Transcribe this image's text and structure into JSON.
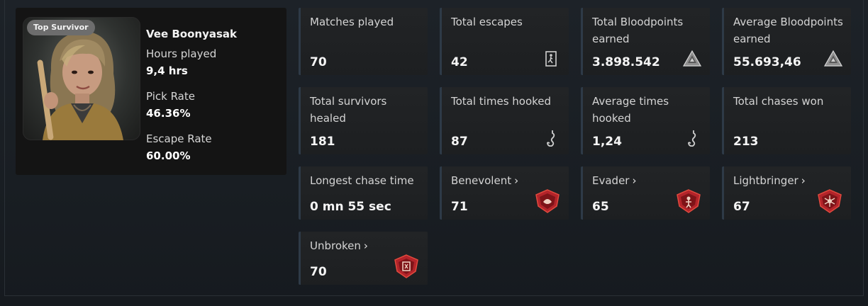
{
  "profile": {
    "badge": "Top Survivor",
    "name": "Vee Boonyasak",
    "stats": [
      {
        "label": "Hours played",
        "value": "9,4 hrs"
      },
      {
        "label": "Pick Rate",
        "value": "46.36%"
      },
      {
        "label": "Escape Rate",
        "value": "60.00%"
      }
    ]
  },
  "stats": [
    {
      "label": "Matches played",
      "value": "70",
      "icon": ""
    },
    {
      "label": "Total escapes",
      "value": "42",
      "icon": "exit-door-icon"
    },
    {
      "label": "Total Bloodpoints earned",
      "value": "3.898.542",
      "icon": "bloodpoints-icon"
    },
    {
      "label": "Average Bloodpoints earned",
      "value": "55.693,46",
      "icon": "bloodpoints-icon"
    },
    {
      "label": "Total survivors healed",
      "value": "181",
      "icon": ""
    },
    {
      "label": "Total times hooked",
      "value": "87",
      "icon": "hook-icon"
    },
    {
      "label": "Average times hooked",
      "value": "1,24",
      "icon": "hook-icon"
    },
    {
      "label": "Total chases won",
      "value": "213",
      "icon": ""
    },
    {
      "label": "Longest chase time",
      "value": "0 mn 55 sec",
      "icon": ""
    },
    {
      "label": "Benevolent",
      "value": "71",
      "icon": "benevolent-emblem-icon"
    },
    {
      "label": "Evader",
      "value": "65",
      "icon": "evader-emblem-icon"
    },
    {
      "label": "Lightbringer",
      "value": "67",
      "icon": "lightbringer-emblem-icon"
    },
    {
      "label": "Unbroken",
      "value": "70",
      "icon": "unbroken-emblem-icon"
    }
  ],
  "emblem_labels": {
    "chevron": "›"
  },
  "colors": {
    "emblem_red": "#c0282a",
    "card_accent": "#2e3a47"
  }
}
